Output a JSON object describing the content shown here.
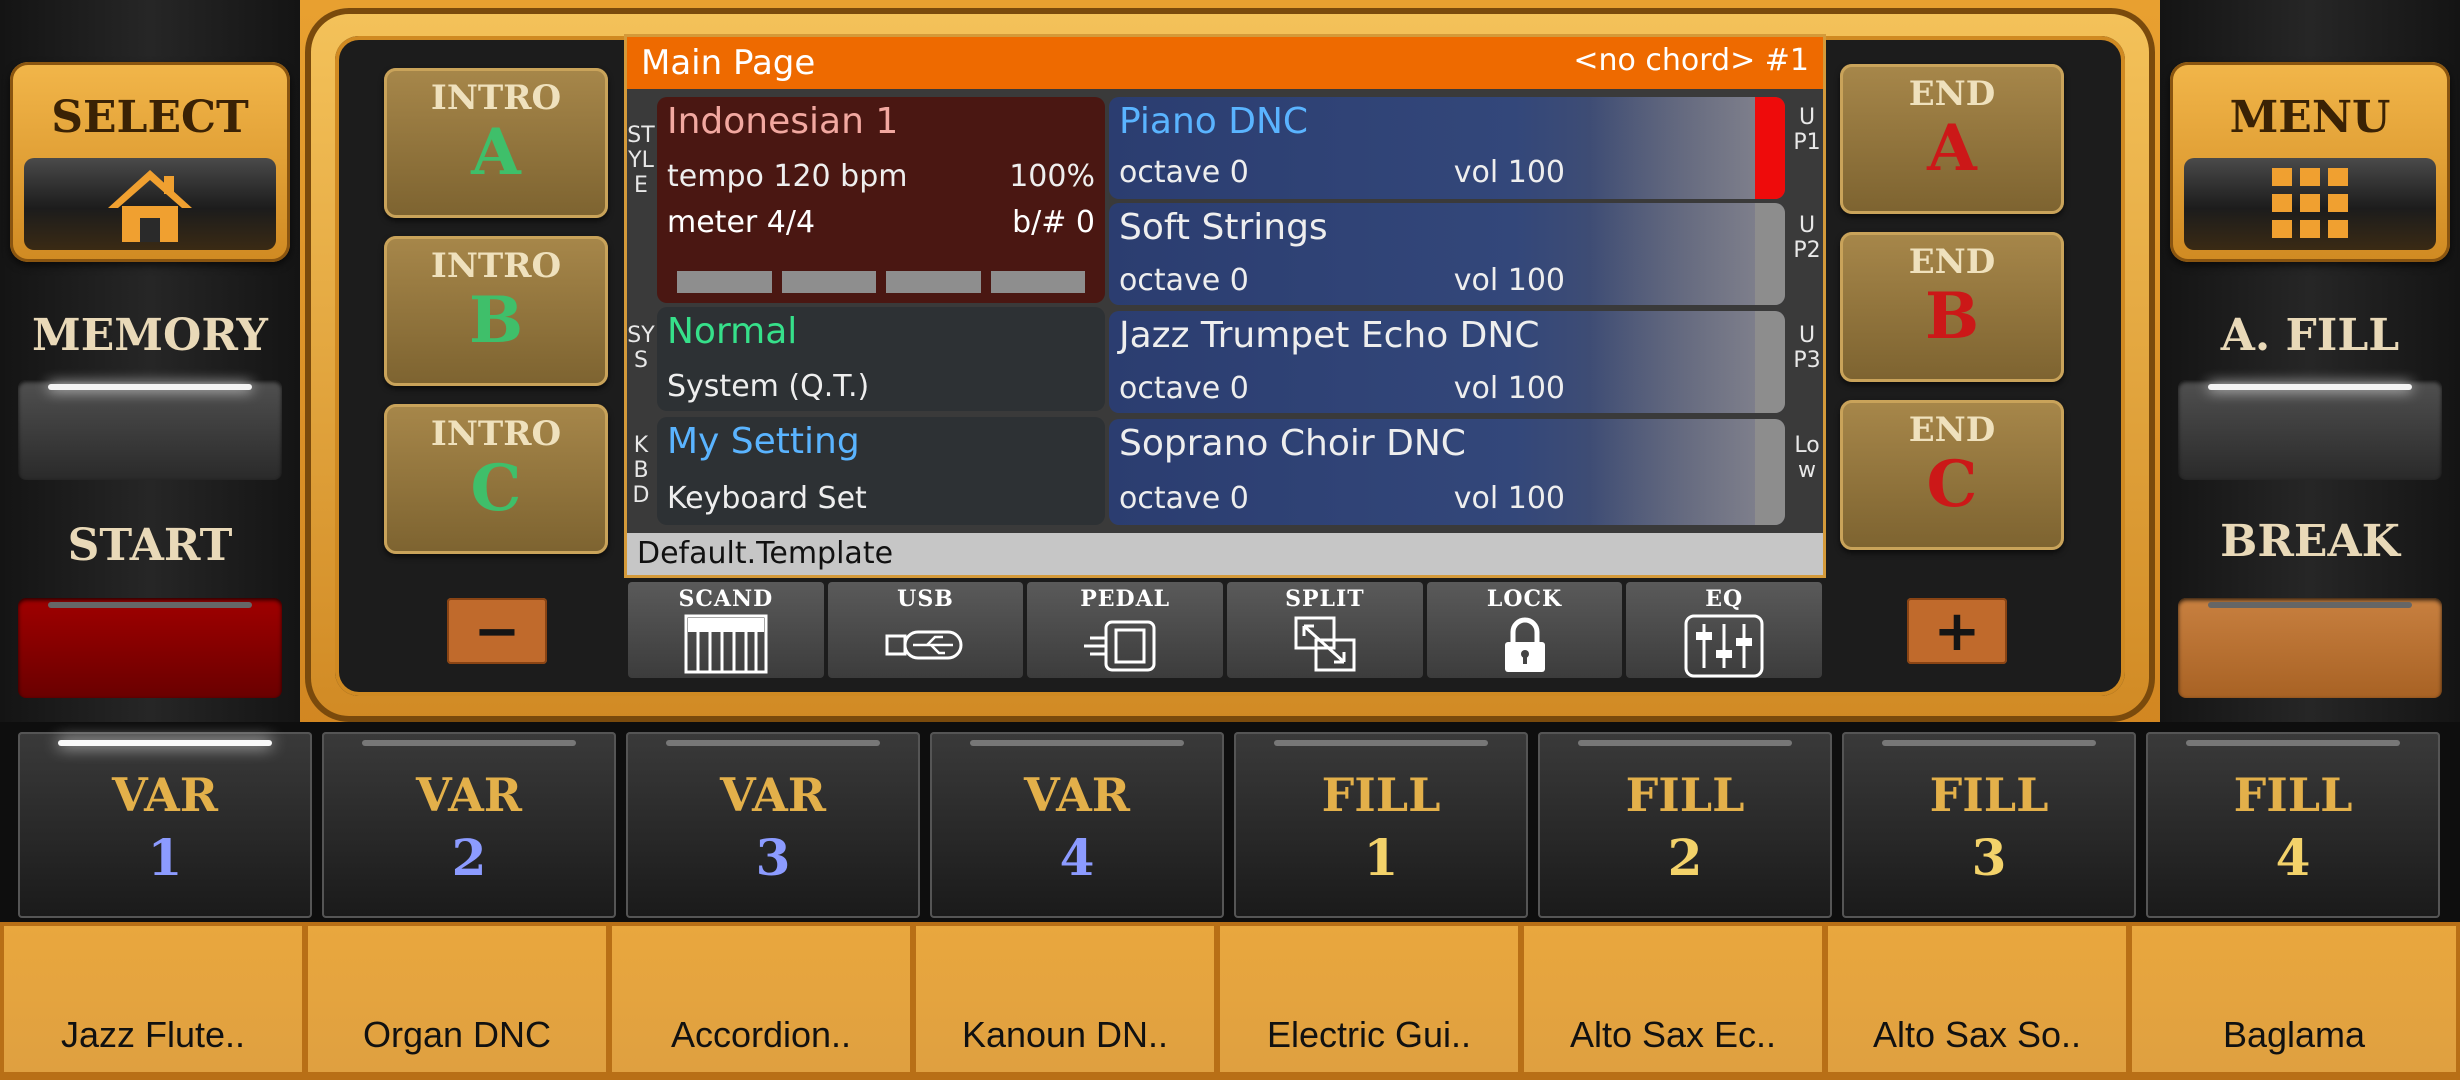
{
  "left_panel": {
    "select_label": "SELECT",
    "memory_label": "MEMORY",
    "start_label": "START"
  },
  "right_panel": {
    "menu_label": "MENU",
    "afill_label": "A. FILL",
    "break_label": "BREAK"
  },
  "intro": [
    {
      "top": "INTRO",
      "letter": "A"
    },
    {
      "top": "INTRO",
      "letter": "B"
    },
    {
      "top": "INTRO",
      "letter": "C"
    }
  ],
  "ending": [
    {
      "top": "END",
      "letter": "A"
    },
    {
      "top": "END",
      "letter": "B"
    },
    {
      "top": "END",
      "letter": "C"
    }
  ],
  "minus_label": "−",
  "plus_label": "+",
  "screen": {
    "title": "Main Page",
    "chord": "<no chord> #1",
    "labels": {
      "style": "STYLE",
      "sys": "SYS",
      "kbd": "KBD",
      "up1": "UP1",
      "up2": "UP2",
      "up3": "UP3",
      "low": "Low"
    },
    "style": {
      "name": "Indonesian 1",
      "tempo": "tempo 120 bpm",
      "percent": "100%",
      "meter": "meter 4/4",
      "accidental": "b/# 0"
    },
    "system": {
      "name": "Normal",
      "sub": "System (Q.T.)"
    },
    "keyboard": {
      "name": "My Setting",
      "sub": "Keyboard Set"
    },
    "voices": [
      {
        "name": "Piano DNC",
        "octave": "octave  0",
        "vol": "vol 100"
      },
      {
        "name": "Soft Strings",
        "octave": "octave  0",
        "vol": "vol 100"
      },
      {
        "name": "Jazz Trumpet Echo DNC",
        "octave": "octave  0",
        "vol": "vol 100"
      },
      {
        "name": "Soprano Choir DNC",
        "octave": "octave  0",
        "vol": "vol 100"
      }
    ],
    "template": "Default.Template"
  },
  "tools": [
    {
      "label": "SCAND",
      "icon": "keyboard-icon"
    },
    {
      "label": "USB",
      "icon": "usb-icon"
    },
    {
      "label": "PEDAL",
      "icon": "pedal-icon"
    },
    {
      "label": "SPLIT",
      "icon": "split-icon"
    },
    {
      "label": "LOCK",
      "icon": "lock-icon"
    },
    {
      "label": "EQ",
      "icon": "equalizer-icon"
    }
  ],
  "variations": [
    {
      "a": "VAR",
      "b": "1"
    },
    {
      "a": "VAR",
      "b": "2"
    },
    {
      "a": "VAR",
      "b": "3"
    },
    {
      "a": "VAR",
      "b": "4"
    },
    {
      "a": "FILL",
      "b": "1"
    },
    {
      "a": "FILL",
      "b": "2"
    },
    {
      "a": "FILL",
      "b": "3"
    },
    {
      "a": "FILL",
      "b": "4"
    }
  ],
  "instruments": [
    "Jazz Flute..",
    "Organ DNC",
    "Accordion..",
    "Kanoun DN..",
    "Electric Gui..",
    "Alto Sax Ec..",
    "Alto Sax So..",
    "Baglama"
  ],
  "colors": {
    "title_bar": "#ee6a00",
    "accent_gold": "#e3b04a",
    "up1_indicator": "#ee0b0b"
  }
}
